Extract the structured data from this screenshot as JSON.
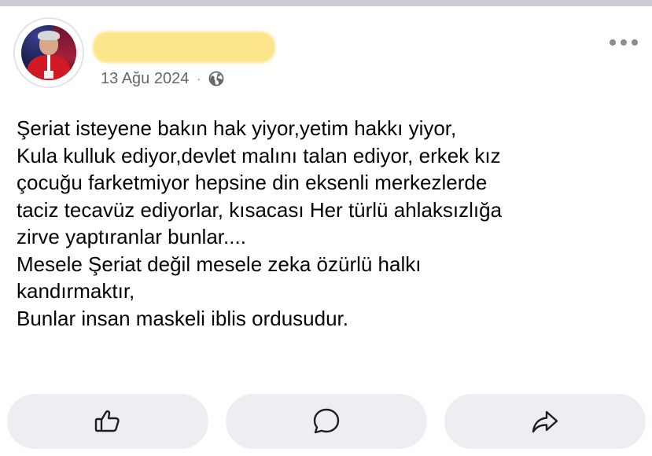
{
  "post": {
    "author_name": "",
    "timestamp": "13 Ağu 2024",
    "separator": "·",
    "privacy_icon": "globe-icon",
    "more_icon": "more-options-icon",
    "lines": [
      "Şeriat isteyene bakın hak yiyor,yetim hakkı yiyor,",
      "Kula kulluk ediyor,devlet malını talan ediyor, erkek kız",
      "çocuğu farketmiyor hepsine din eksenli merkezlerde",
      "taciz tecavüz ediyorlar, kısacası Her türlü ahlaksızlığa",
      "zirve yaptıranlar bunlar....",
      "Mesele Şeriat değil mesele zeka özürlü halkı",
      "kandırmaktır,",
      "Bunlar insan maskeli iblis ordusudur."
    ]
  },
  "actions": [
    {
      "icon": "thumbs-up-icon"
    },
    {
      "icon": "comment-icon"
    },
    {
      "icon": "share-icon"
    }
  ],
  "colors": {
    "text": "#050505",
    "meta": "#65676b",
    "action_bg": "#eceef1",
    "redaction": "#fbe48a"
  }
}
